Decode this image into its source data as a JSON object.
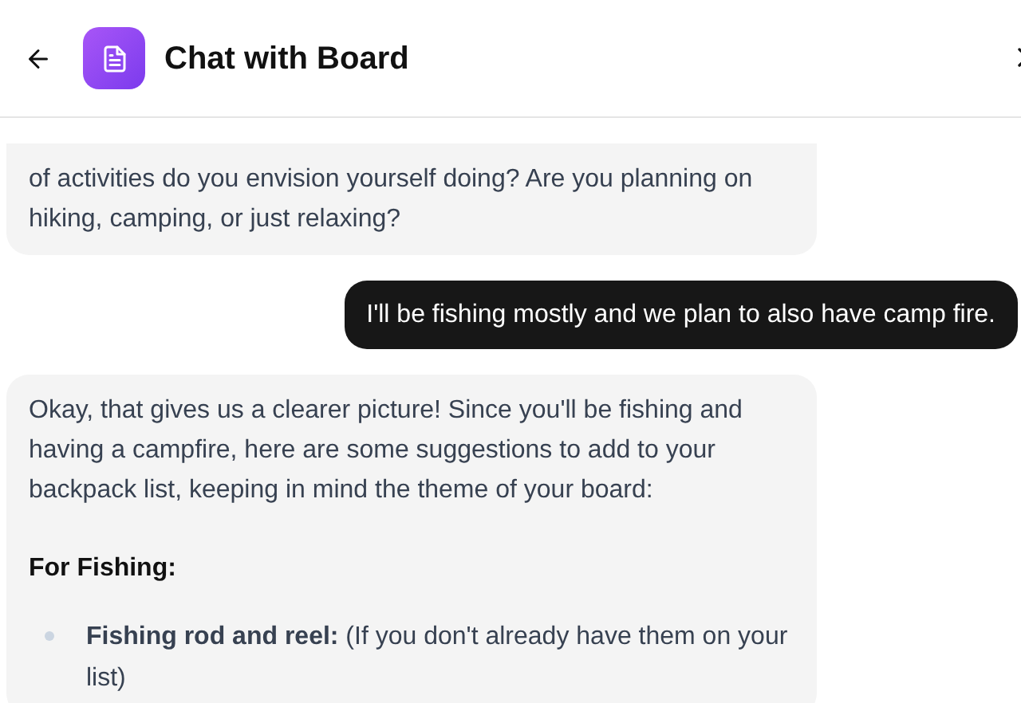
{
  "header": {
    "title": "Chat with Board"
  },
  "messages": [
    {
      "kind": "bot",
      "blocks": [
        {
          "kind": "paragraph",
          "text": "of activities do you envision yourself doing? Are you planning on hiking, camping, or just relaxing?"
        }
      ]
    },
    {
      "kind": "user",
      "blocks": [
        {
          "kind": "paragraph",
          "text": "I'll be fishing mostly and we plan to also have camp fire."
        }
      ]
    },
    {
      "kind": "bot",
      "blocks": [
        {
          "kind": "paragraph",
          "text": "Okay, that gives us a clearer picture! Since you'll be fishing and having a campfire, here are some suggestions to add to your backpack list, keeping in mind the theme of your board:"
        },
        {
          "kind": "heading",
          "text": "For Fishing:"
        },
        {
          "kind": "bullet",
          "text": "**Fishing rod and reel:** (If you don't already have them on your list)"
        }
      ]
    }
  ]
}
